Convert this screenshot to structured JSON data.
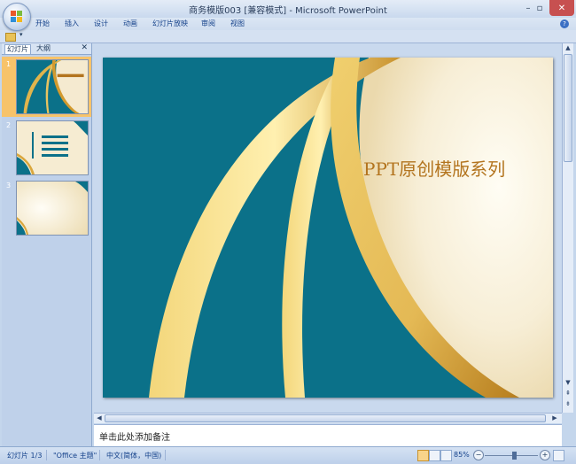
{
  "window": {
    "title": "商务模版003 [兼容模式] - Microsoft PowerPoint",
    "minimize": "–",
    "maximize": "▫",
    "close": "✕"
  },
  "ribbon": {
    "tabs": [
      "开始",
      "插入",
      "设计",
      "动画",
      "幻灯片放映",
      "审阅",
      "视图"
    ],
    "help": "?"
  },
  "slides_pane": {
    "tabs": [
      "幻灯片",
      "大纲"
    ],
    "close": "✕",
    "slides": [
      {
        "number": "1",
        "selected": true
      },
      {
        "number": "2",
        "selected": false
      },
      {
        "number": "3",
        "selected": false
      }
    ]
  },
  "slide": {
    "title": "PPT原创模版系列",
    "colors": {
      "teal": "#0b7189",
      "cream": "#f7eed6",
      "gold": "#d9a63c"
    }
  },
  "notes": {
    "placeholder": "单击此处添加备注"
  },
  "status": {
    "slide_position": "幻灯片 1/3",
    "theme": "\"Office 主题\"",
    "language": "中文(简体，中国)",
    "zoom": "85%",
    "zoom_fraction": 0.55
  }
}
